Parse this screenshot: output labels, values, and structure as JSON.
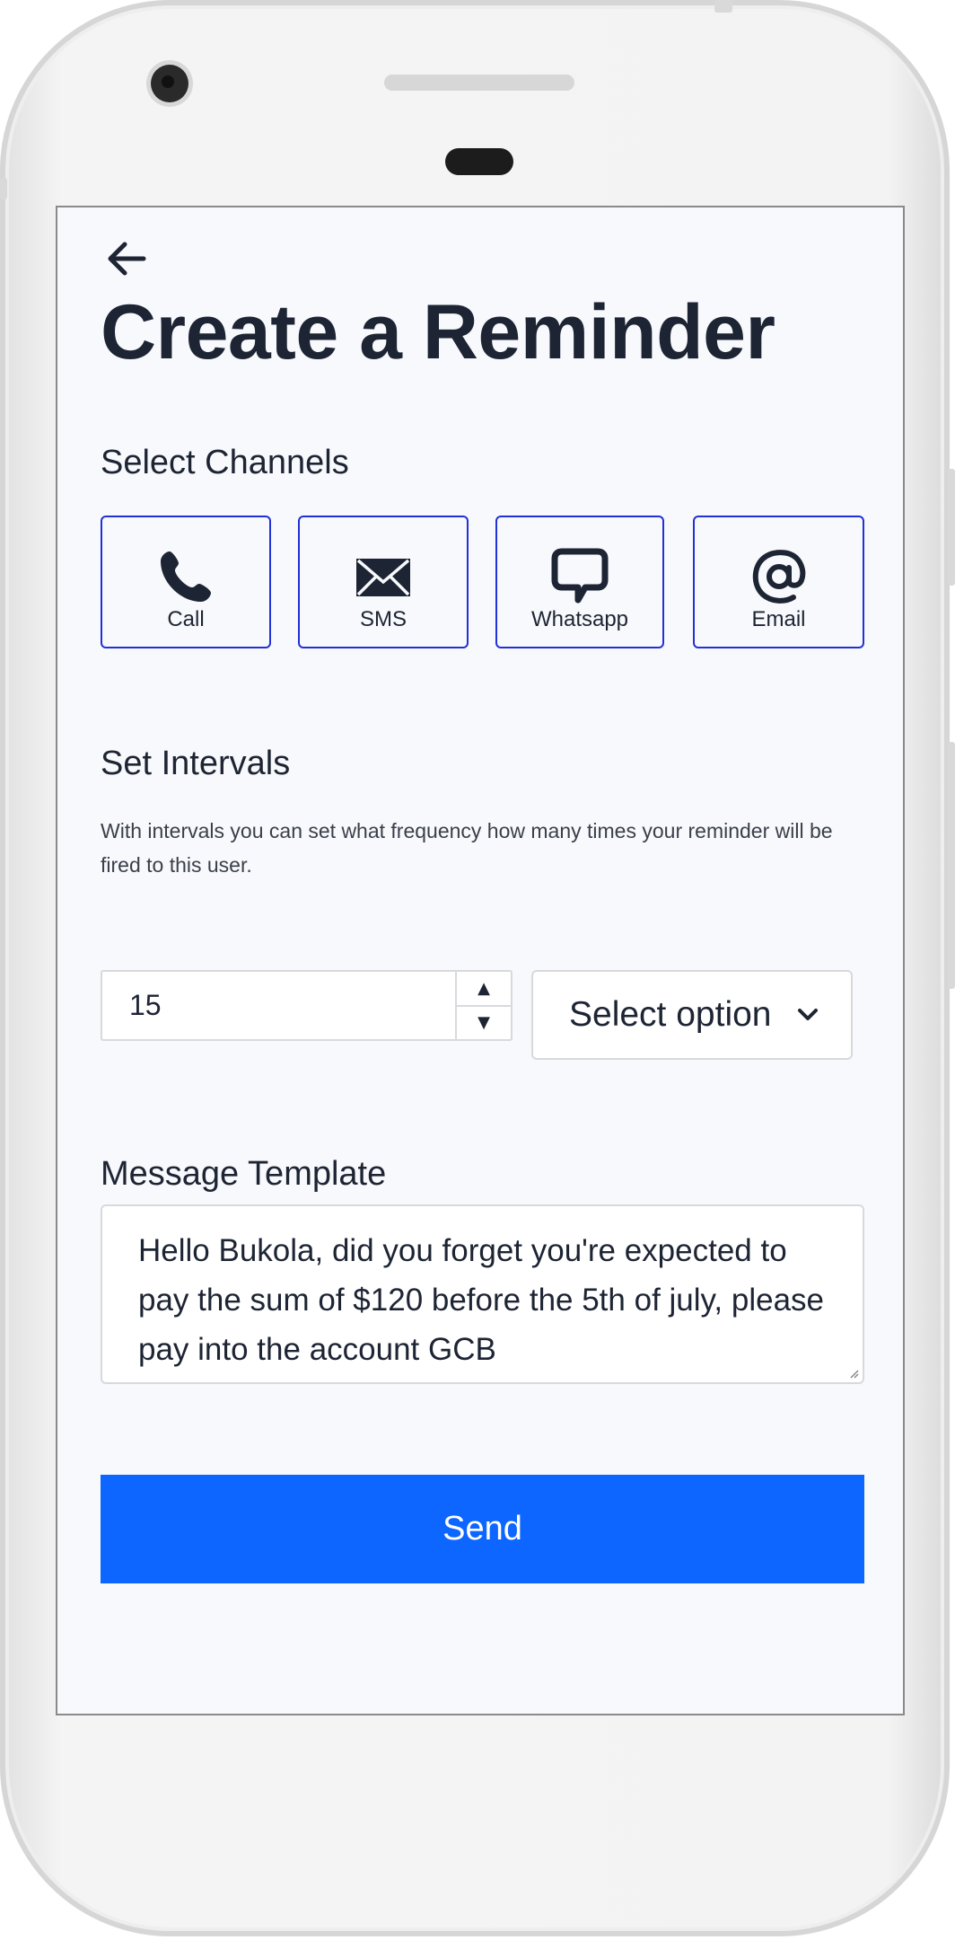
{
  "header": {
    "back_icon": "arrow-left-icon",
    "title": "Create a Reminder"
  },
  "channels": {
    "label": "Select Channels",
    "accent_color": "#2230d8",
    "items": [
      {
        "label": "Call",
        "icon": "phone-icon"
      },
      {
        "label": "SMS",
        "icon": "envelope-icon"
      },
      {
        "label": "Whatsapp",
        "icon": "chat-bubble-icon"
      },
      {
        "label": "Email",
        "icon": "at-sign-icon"
      }
    ]
  },
  "intervals": {
    "label": "Set Intervals",
    "description": "With intervals you can set what frequency how many times your reminder will be fired to this user.",
    "number_value": "15",
    "select_value": "Select option"
  },
  "message": {
    "label": "Message Template",
    "value": "Hello Bukola, did you forget you're expected to pay the sum of $120 before the 5th of july, please pay into the account GCB"
  },
  "actions": {
    "send_label": "Send",
    "send_color": "#0d66ff"
  }
}
